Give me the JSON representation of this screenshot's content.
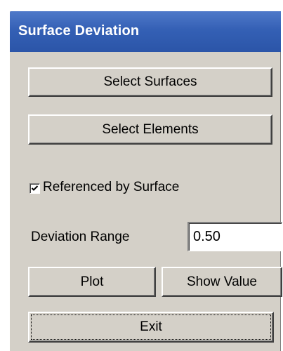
{
  "window": {
    "title": "Surface Deviation"
  },
  "buttons": {
    "select_surfaces": "Select Surfaces",
    "select_elements": "Select Elements",
    "plot": "Plot",
    "show_value": "Show Value",
    "exit": "Exit"
  },
  "checkbox": {
    "label": "Referenced by Surface",
    "checked": true
  },
  "deviation_range": {
    "label": "Deviation Range",
    "value": "0.50"
  },
  "colors": {
    "titlebar": "#3460b5",
    "face": "#d4d0c8"
  }
}
